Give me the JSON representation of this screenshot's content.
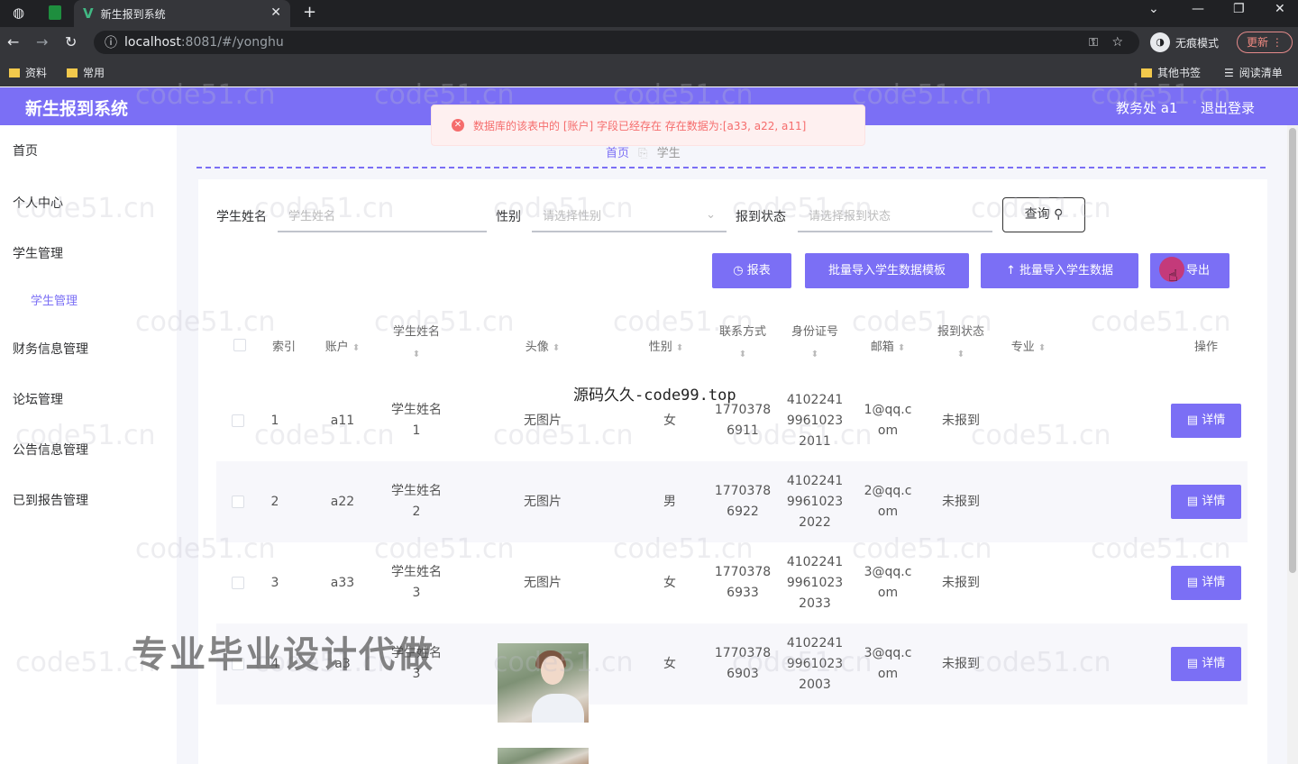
{
  "browser": {
    "tab_title": "新生报到系统",
    "url_host": "localhost",
    "url_path": ":8081/#/yonghu",
    "incognito_label": "无痕模式",
    "update_label": "更新",
    "bookmarks": [
      "资料",
      "常用"
    ],
    "other_bookmarks": "其他书签",
    "reading_list": "阅读清单"
  },
  "app": {
    "brand": "新生报到系统",
    "user": "教务处 a1",
    "logout": "退出登录"
  },
  "sidebar": {
    "items": [
      "首页",
      "个人中心",
      "学生管理",
      "学生管理",
      "财务信息管理",
      "论坛管理",
      "公告信息管理",
      "已到报告管理"
    ]
  },
  "toast": {
    "message": "数据库的该表中的 [账户] 字段已经存在 存在数据为:[a33, a22, a11]"
  },
  "breadcrumb": {
    "home": "首页",
    "current": "学生"
  },
  "filters": {
    "name_label": "学生姓名",
    "name_placeholder": "学生姓名",
    "gender_label": "性别",
    "gender_placeholder": "请选择性别",
    "status_label": "报到状态",
    "status_placeholder": "请选择报到状态",
    "query": "查询"
  },
  "actions": {
    "report": "报表",
    "template": "批量导入学生数据模板",
    "import": "批量导入学生数据",
    "export": "导出"
  },
  "table": {
    "headers": {
      "index": "索引",
      "account": "账户",
      "name": "学生姓名",
      "avatar": "头像",
      "gender": "性别",
      "phone": "联系方式",
      "idcard": "身份证号",
      "email": "邮箱",
      "status": "报到状态",
      "major": "专业",
      "ops": "操作"
    },
    "detail_label": "详情",
    "rows": [
      {
        "index": "1",
        "account": "a11",
        "name1": "学生姓名",
        "name2": "1",
        "avatar": "无图片",
        "gender": "女",
        "phone1": "1770378",
        "phone2": "6911",
        "id1": "4102241",
        "id2": "9961023",
        "id3": "2011",
        "email1": "1@qq.c",
        "email2": "om",
        "status": "未报到"
      },
      {
        "index": "2",
        "account": "a22",
        "name1": "学生姓名",
        "name2": "2",
        "avatar": "无图片",
        "gender": "男",
        "phone1": "1770378",
        "phone2": "6922",
        "id1": "4102241",
        "id2": "9961023",
        "id3": "2022",
        "email1": "2@qq.c",
        "email2": "om",
        "status": "未报到"
      },
      {
        "index": "3",
        "account": "a33",
        "name1": "学生姓名",
        "name2": "3",
        "avatar": "无图片",
        "gender": "女",
        "phone1": "1770378",
        "phone2": "6933",
        "id1": "4102241",
        "id2": "9961023",
        "id3": "2033",
        "email1": "3@qq.c",
        "email2": "om",
        "status": "未报到"
      },
      {
        "index": "4",
        "account": "a3",
        "name1": "学生姓名",
        "name2": "3",
        "avatar": "",
        "gender": "女",
        "phone1": "1770378",
        "phone2": "6903",
        "id1": "4102241",
        "id2": "9961023",
        "id3": "2003",
        "email1": "3@qq.c",
        "email2": "om",
        "status": "未报到"
      }
    ]
  },
  "overlay": {
    "watermark": "code51.cn",
    "promo": "专业毕业设计代做",
    "site": "源码久久-code99.top"
  }
}
